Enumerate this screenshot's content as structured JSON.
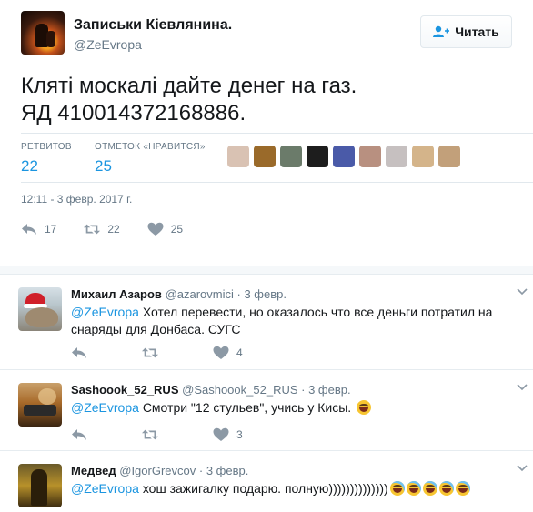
{
  "main_tweet": {
    "author_name": "Записьки Кіевлянина.",
    "author_handle": "@ZeEvropa",
    "follow_label": "Читать",
    "text_line1": "Кляті москалі дайте денег на газ.",
    "text_line2": "ЯД 410014372168886.",
    "retweets_label": "РЕТВИТОВ",
    "retweets_count": "22",
    "likes_label": "ОТМЕТОК «НРАВИТСЯ»",
    "likes_count": "25",
    "timestamp": "12:11 - 3 февр. 2017 г.",
    "actions": {
      "replies": "17",
      "retweets": "22",
      "likes": "25"
    }
  },
  "likers": [
    {
      "name": "liker-1",
      "color": "#d9c2b3"
    },
    {
      "name": "liker-2",
      "color": "#9a6a2a"
    },
    {
      "name": "liker-3",
      "color": "#6b7b6a"
    },
    {
      "name": "liker-4",
      "color": "#1d1d1d"
    },
    {
      "name": "liker-5",
      "color": "#4a5aa8"
    },
    {
      "name": "liker-6",
      "color": "#b89080"
    },
    {
      "name": "liker-7",
      "color": "#c6c0c0"
    },
    {
      "name": "liker-8",
      "color": "#d4b48a"
    },
    {
      "name": "liker-9",
      "color": "#c2a07a"
    }
  ],
  "replies": [
    {
      "name": "Михаил Азаров",
      "handle": "@azarovmici",
      "date": "· 3 февр.",
      "mention": "@ZeEvropa",
      "text": "Хотел перевести, но оказалось что все деньги потратил на снаряды для Донбаса. СУГС",
      "likes": "4"
    },
    {
      "name": "Sashoook_52_RUS",
      "handle": "@Sashoook_52_RUS",
      "date": "· 3 февр.",
      "mention": "@ZeEvropa",
      "text": "Смотри \"12 стульев\", учись у Кисы.",
      "likes": "3"
    },
    {
      "name": "Медвед",
      "handle": "@IgorGrevcov",
      "date": "· 3 февр.",
      "mention": "@ZeEvropa",
      "text": "хош зажигалку подарю. полную))))))))))))))"
    }
  ],
  "colors": {
    "link": "#1b95e0",
    "secondary": "#657786",
    "icon": "#8c99a5"
  },
  "icons": [
    "reply-icon",
    "retweet-icon",
    "heart-icon",
    "follow-user-icon",
    "chevron-down-icon",
    "emoji-grin-icon",
    "emoji-tears-of-joy-icon"
  ]
}
